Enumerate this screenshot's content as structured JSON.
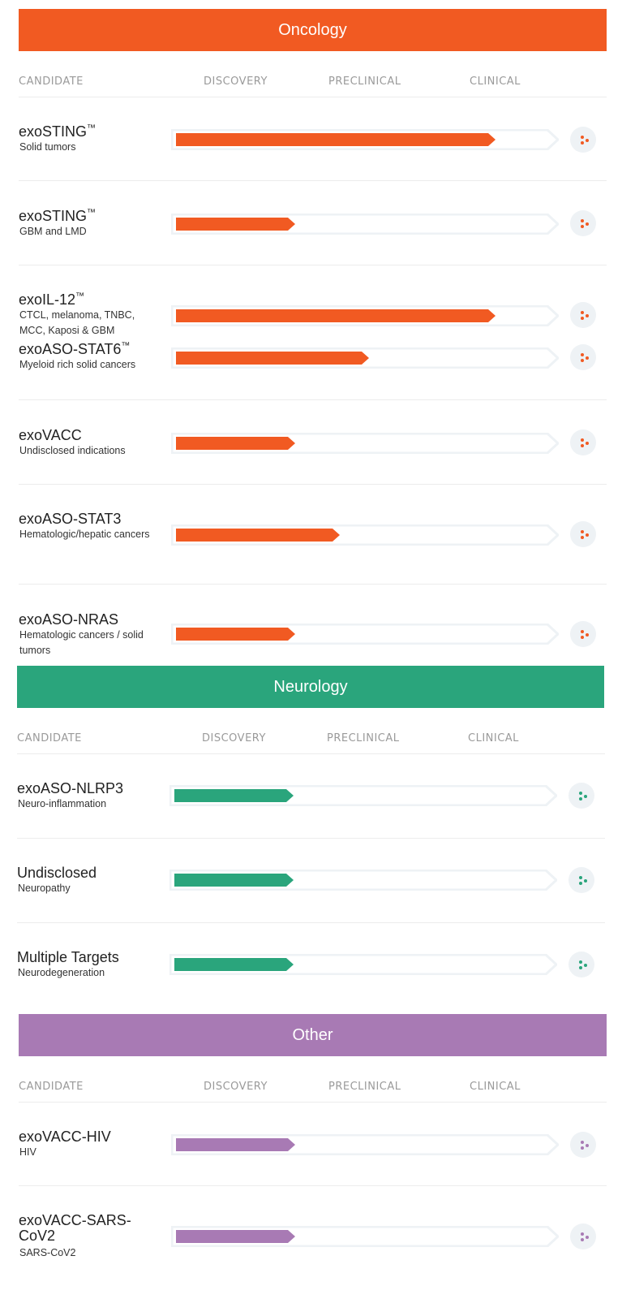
{
  "sections": {
    "oncology": {
      "title": "Oncology",
      "color": "#f15a22",
      "headers": [
        "CANDIDATE",
        "DISCOVERY",
        "PRECLINICAL",
        "CLINICAL"
      ],
      "rows": [
        {
          "name": "exoSTING",
          "tm": "™",
          "indication": "Solid tumors",
          "progress": 0.86
        },
        {
          "name": "exoSTING",
          "tm": "™",
          "indication": "GBM and LMD",
          "progress": 0.32
        },
        {
          "name": "exoIL-12",
          "tm": "™",
          "indication": "CTCL, melanoma, TNBC, MCC, Kaposi & GBM",
          "progress": 0.86
        },
        {
          "name": "exoASO-STAT6",
          "tm": "™",
          "indication": "Myeloid rich solid cancers",
          "progress": 0.52
        },
        {
          "name": "exoVACC",
          "tm": "",
          "indication": "Undisclosed indications",
          "progress": 0.32
        },
        {
          "name": "exoASO-STAT3",
          "tm": "",
          "indication": "Hematologic/hepatic cancers",
          "progress": 0.44
        },
        {
          "name": "exoASO-NRAS",
          "tm": "",
          "indication": "Hematologic cancers / solid tumors",
          "progress": 0.32
        }
      ]
    },
    "neurology": {
      "title": "Neurology",
      "color": "#2aa57c",
      "headers": [
        "CANDIDATE",
        "DISCOVERY",
        "PRECLINICAL",
        "CLINICAL"
      ],
      "rows": [
        {
          "name": "exoASO-NLRP3",
          "tm": "",
          "indication": "Neuro-inflammation",
          "progress": 0.32
        },
        {
          "name": "Undisclosed",
          "tm": "",
          "indication": "Neuropathy",
          "progress": 0.32
        },
        {
          "name": "Multiple Targets",
          "tm": "",
          "indication": "Neurodegeneration",
          "progress": 0.32
        }
      ]
    },
    "other": {
      "title": "Other",
      "color": "#a87ab4",
      "headers": [
        "CANDIDATE",
        "DISCOVERY",
        "PRECLINICAL",
        "CLINICAL"
      ],
      "rows": [
        {
          "name": "exoVACC-HIV",
          "tm": "",
          "indication": "HIV",
          "progress": 0.32
        },
        {
          "name": "exoVACC-SARS-CoV2",
          "tm": "",
          "indication": "SARS-CoV2",
          "progress": 0.32
        }
      ]
    }
  },
  "icons": {
    "row_action": "share-icon"
  }
}
